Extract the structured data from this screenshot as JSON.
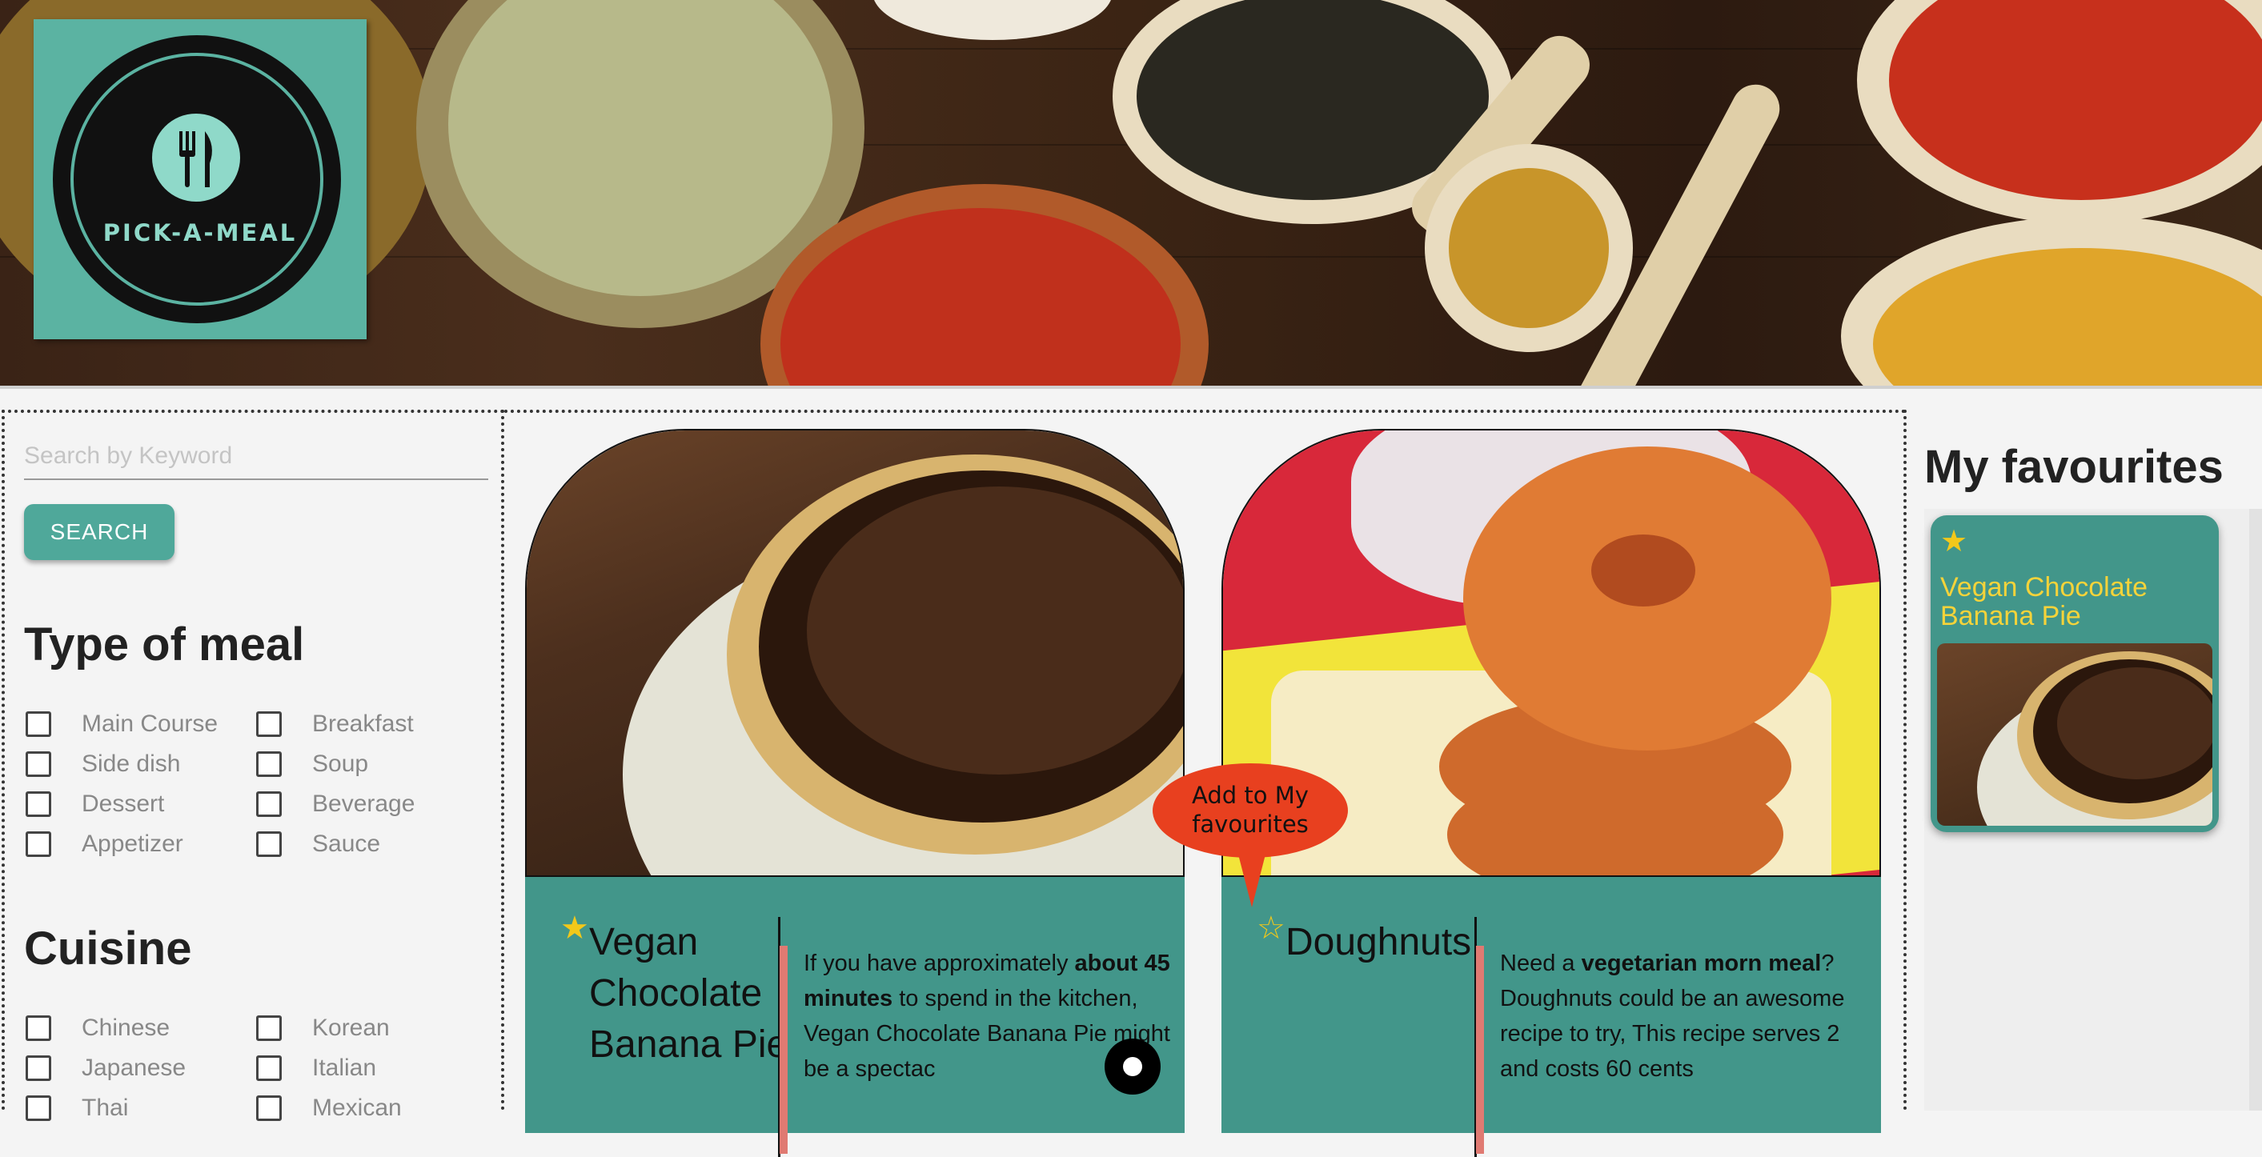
{
  "header": {
    "brand": "PICK-A-MEAL"
  },
  "search": {
    "placeholder": "Search by Keyword",
    "value": "",
    "button_label": "SEARCH"
  },
  "filters": {
    "meal_type": {
      "title": "Type of meal",
      "options": [
        "Main Course",
        "Breakfast",
        "Side dish",
        "Soup",
        "Dessert",
        "Beverage",
        "Appetizer",
        "Sauce"
      ]
    },
    "cuisine": {
      "title": "Cuisine",
      "options": [
        "Chinese",
        "Korean",
        "Japanese",
        "Italian",
        "Thai",
        "Mexican"
      ]
    }
  },
  "recipes": [
    {
      "title": "Vegan Chocolate Banana Pie",
      "star": "★",
      "favourited": true,
      "desc_1": "If you have approximately ",
      "desc_bold_1": "about 45 minutes",
      "desc_2": " to spend in the kitchen, Vegan Chocolate Banana Pie might be a spectac",
      "image_icon": "pie-photo"
    },
    {
      "title": "Doughnuts",
      "star": "☆",
      "favourited": false,
      "desc_1": "Need a ",
      "desc_bold_1": "vegetarian morn meal",
      "desc_2": "? Doughnuts could be an awesome recipe to try, This recipe serves 2 and costs 60 cents",
      "image_icon": "doughnut-photo"
    }
  ],
  "tooltip": {
    "text": "Add to My favourites"
  },
  "favourites": {
    "title": "My favourites",
    "items": [
      {
        "star": "★",
        "name": "Vegan Chocolate Banana Pie"
      }
    ]
  },
  "colors": {
    "teal": "#42968a",
    "logo_teal": "#5bb3a2",
    "tooltip": "#e8401f",
    "star": "#f2c81a",
    "fav_text": "#f5d33a",
    "accent_bar": "#e07a72"
  }
}
